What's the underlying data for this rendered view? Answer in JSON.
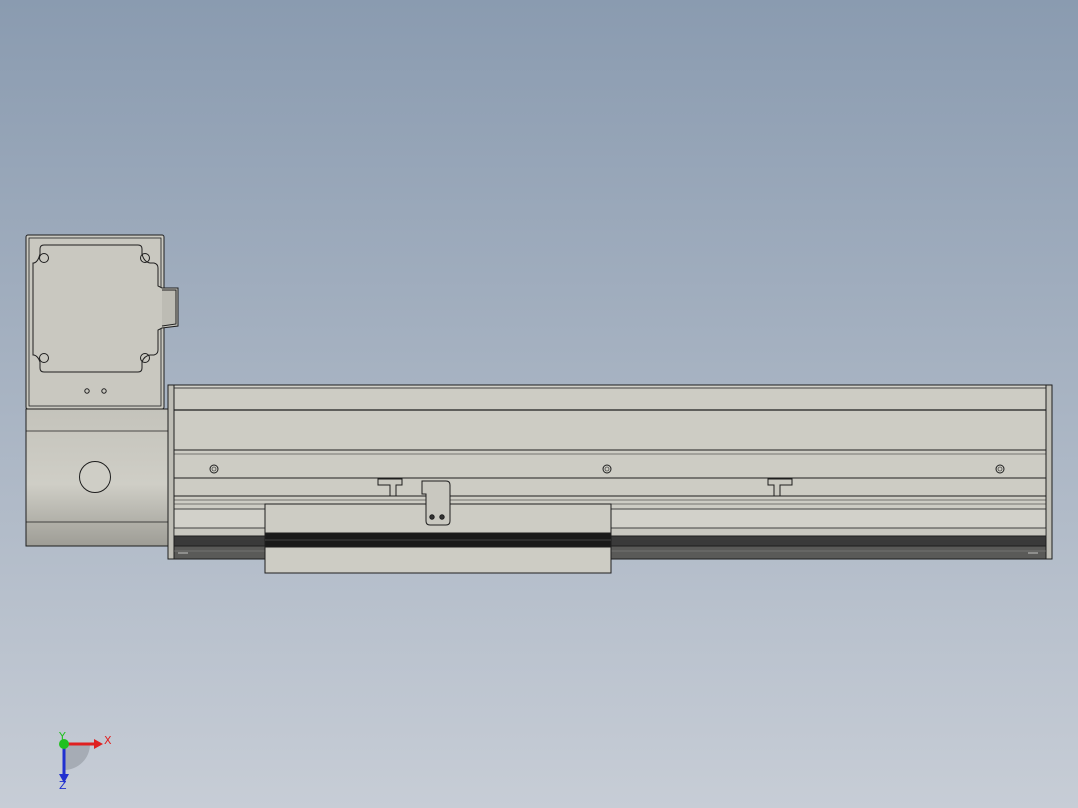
{
  "viewport": {
    "background_top": "#8a9bb0",
    "background_bottom": "#c7cdd6"
  },
  "model": {
    "body_fill": "#c9c8c0",
    "body_fill_light": "#d2d1ca",
    "edge_color": "#1e1e1e",
    "dark_band": "#2a2a2a",
    "hole_count_rail": 3
  },
  "triad": {
    "x_label": "X",
    "y_label": "Y",
    "z_label": "Z",
    "x_color": "#e02020",
    "y_color": "#20c020",
    "z_color": "#2030d0"
  }
}
